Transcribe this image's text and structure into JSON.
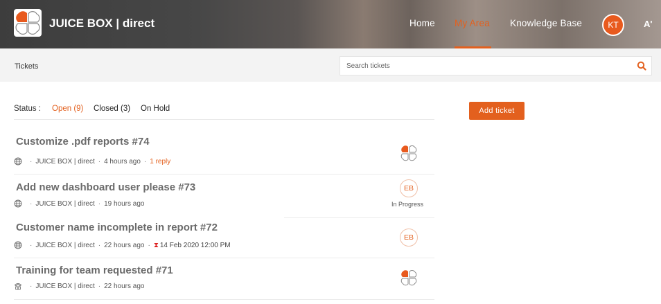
{
  "header": {
    "brand": "JUICE BOX | direct",
    "nav": {
      "home": "Home",
      "my_area": "My Area",
      "knowledge_base": "Knowledge Base"
    },
    "user_initials": "KT",
    "font_size_toggle": "A'",
    "accent_color": "#e3601e"
  },
  "subbar": {
    "breadcrumb": "Tickets",
    "search_placeholder": "Search tickets"
  },
  "status": {
    "label": "Status :",
    "tabs": [
      "Open (9)",
      "Closed (3)",
      "On Hold"
    ],
    "active": "Open (9)"
  },
  "add_ticket_label": "Add ticket",
  "tickets": [
    {
      "title": "Customize .pdf reports #74",
      "channel_icon": "globe-icon",
      "company": "JUICE BOX | direct",
      "time": "4 hours ago",
      "replies": "1 reply",
      "assignee": "juicebox-logo"
    },
    {
      "title": "Add new dashboard user please #73",
      "channel_icon": "globe-icon",
      "company": "JUICE BOX | direct",
      "time": "19 hours ago",
      "assignee": "EB",
      "status": "In Progress"
    },
    {
      "title": "Customer name incomplete in report #72",
      "channel_icon": "globe-icon",
      "company": "JUICE BOX | direct",
      "time": "22 hours ago",
      "due": "14 Feb 2020 12:00 PM",
      "assignee": "EB"
    },
    {
      "title": "Training for team requested #71",
      "channel_icon": "phone-icon",
      "company": "JUICE BOX | direct",
      "time": "22 hours ago",
      "assignee": "juicebox-logo"
    }
  ]
}
